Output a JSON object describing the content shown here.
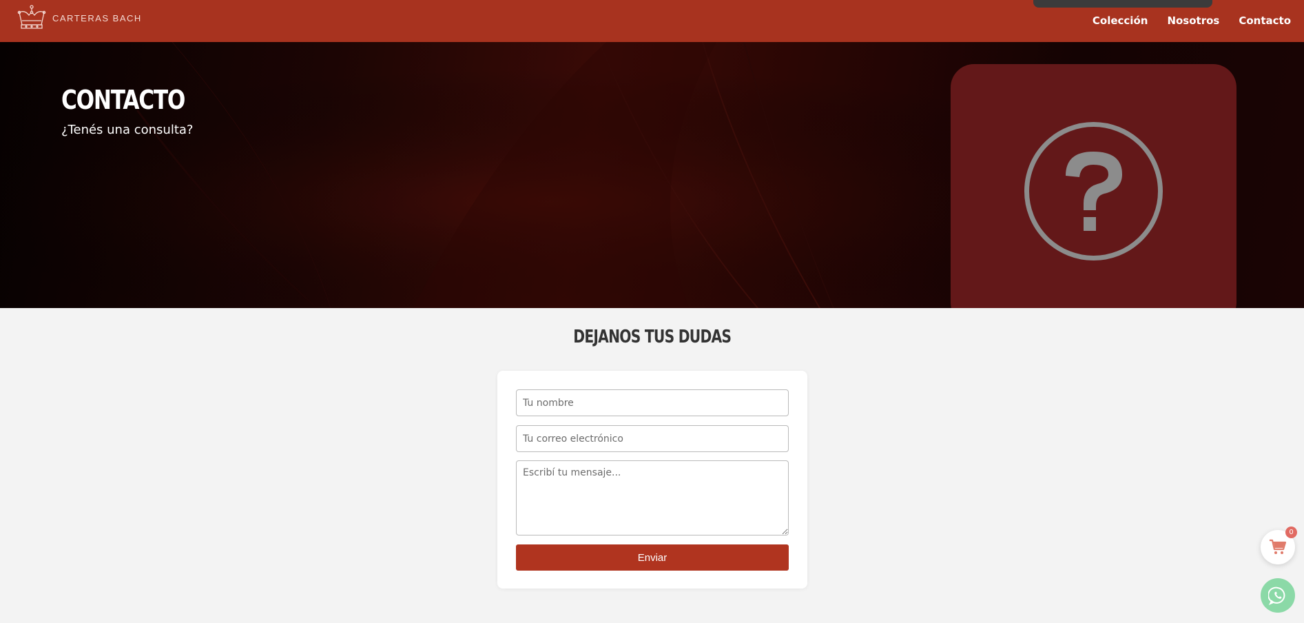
{
  "header": {
    "brand": "CARTERAS BACH",
    "nav": [
      {
        "label": "Colección"
      },
      {
        "label": "Nosotros"
      },
      {
        "label": "Contacto"
      }
    ]
  },
  "hero": {
    "title": "CONTACTO",
    "subtitle": "¿Tenés una consulta?"
  },
  "section": {
    "title": "DEJANOS TUS DUDAS"
  },
  "form": {
    "name_placeholder": "Tu nombre",
    "email_placeholder": "Tu correo electrónico",
    "message_placeholder": "Escribí tu mensaje...",
    "submit_label": "Enviar"
  },
  "cart": {
    "count": "0"
  },
  "colors": {
    "header": "#a8331f",
    "accent": "#b0341f",
    "card": "#631819",
    "whatsapp": "#8bd9a7"
  },
  "icons": [
    "crown-logo-icon",
    "question-icon",
    "cart-icon",
    "whatsapp-icon"
  ]
}
